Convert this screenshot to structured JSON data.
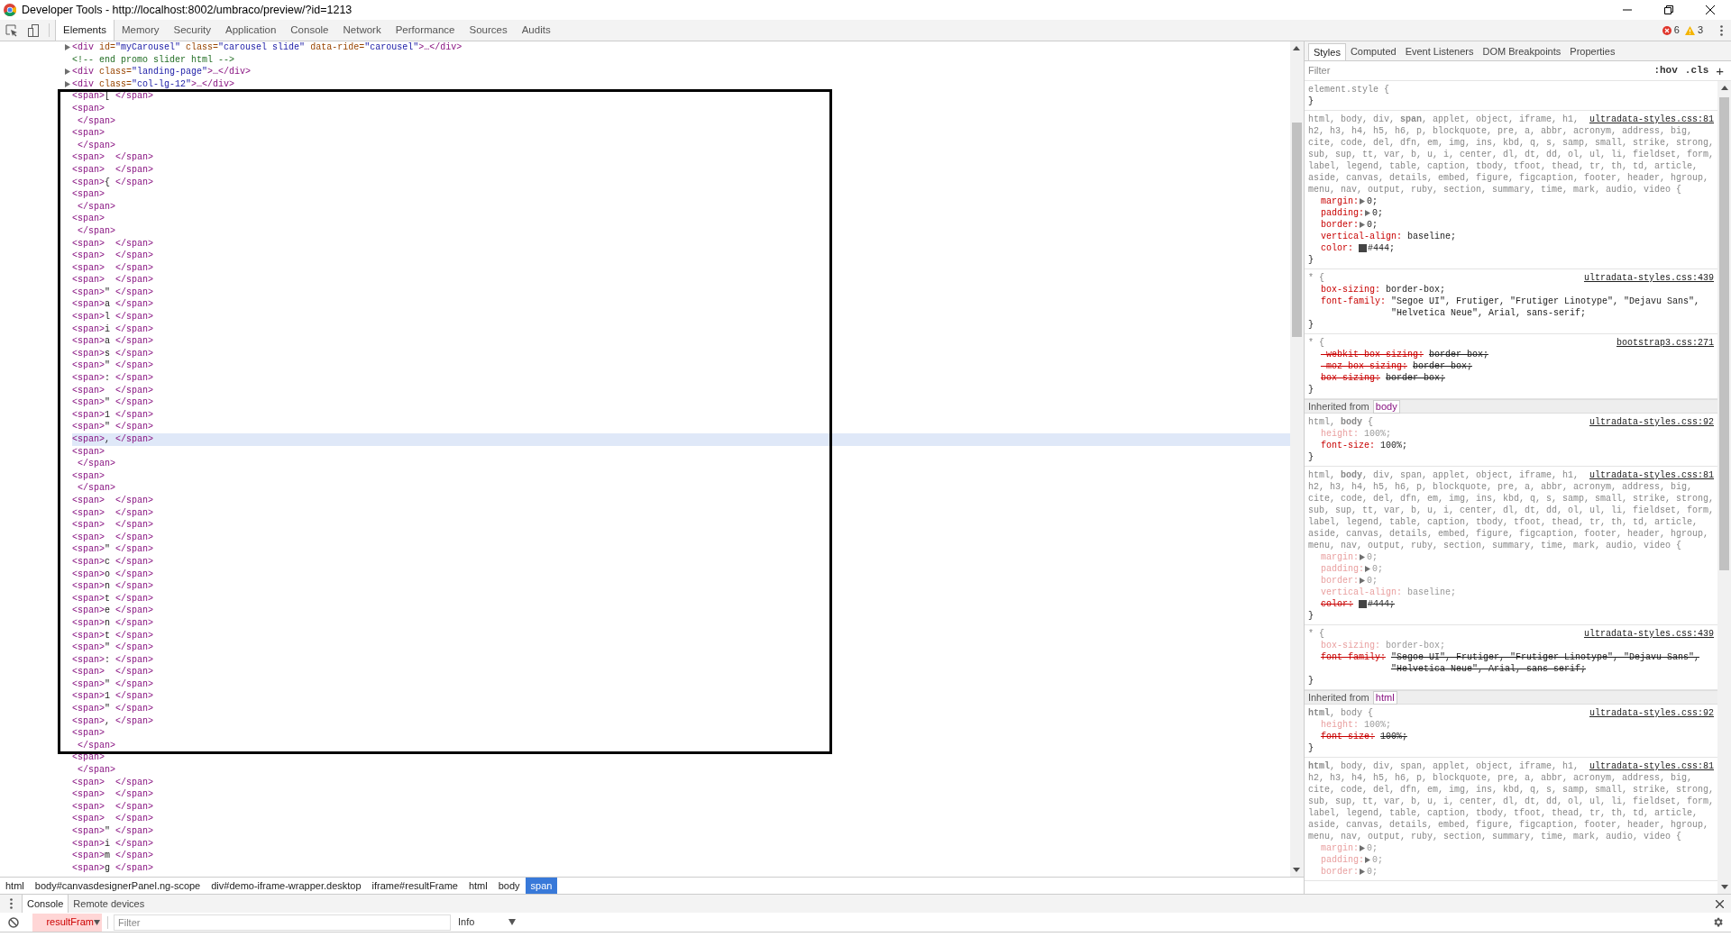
{
  "window": {
    "title": "Developer Tools - http://localhost:8002/umbraco/preview/?id=1213"
  },
  "toolbar": {
    "tabs": [
      {
        "label": "Elements",
        "selected": true
      },
      {
        "label": "Memory",
        "selected": false
      },
      {
        "label": "Security",
        "selected": false
      },
      {
        "label": "Application",
        "selected": false
      },
      {
        "label": "Console",
        "selected": false
      },
      {
        "label": "Network",
        "selected": false
      },
      {
        "label": "Performance",
        "selected": false
      },
      {
        "label": "Sources",
        "selected": false
      },
      {
        "label": "Audits",
        "selected": false
      }
    ],
    "errors": "6",
    "warnings": "3"
  },
  "elements": {
    "lines": [
      {
        "kind": "collapsed",
        "open": "<div",
        "attrs": [
          {
            "name": "id=",
            "value": "\"myCarousel\""
          },
          {
            "name": "class=",
            "value": "\"carousel slide\""
          },
          {
            "name": "data-ride=",
            "value": "\"carousel\""
          }
        ],
        "close": ">…</div>",
        "selected": false
      },
      {
        "kind": "comment",
        "text": "<!-- end promo slider html -->",
        "selected": false
      },
      {
        "kind": "collapsed",
        "open": "<div",
        "attrs": [
          {
            "name": "class=",
            "value": "\"landing-page\""
          }
        ],
        "close": ">…</div>",
        "selected": false
      },
      {
        "kind": "collapsed",
        "open": "<div",
        "attrs": [
          {
            "name": "class=",
            "value": "\"col-lg-12\""
          }
        ],
        "close": ">…</div>",
        "selected": false
      },
      {
        "kind": "span",
        "open": "<span>",
        "content": "[ ",
        "close": "</span>",
        "selected": false
      },
      {
        "kind": "open",
        "open": "<span>",
        "selected": false
      },
      {
        "kind": "close",
        "close": " </span>",
        "selected": false
      },
      {
        "kind": "open",
        "open": "<span>",
        "selected": false
      },
      {
        "kind": "close",
        "close": " </span>",
        "selected": false
      },
      {
        "kind": "span",
        "open": "<span>",
        "close": "</span>",
        "selected": false
      },
      {
        "kind": "span",
        "open": "<span>",
        "close": "</span>",
        "selected": false
      },
      {
        "kind": "span",
        "open": "<span>",
        "content": "{ ",
        "close": "</span>",
        "selected": false
      },
      {
        "kind": "open",
        "open": "<span>",
        "selected": false
      },
      {
        "kind": "close",
        "close": " </span>",
        "selected": false
      },
      {
        "kind": "open",
        "open": "<span>",
        "selected": false
      },
      {
        "kind": "close",
        "close": " </span>",
        "selected": false
      },
      {
        "kind": "span",
        "open": "<span>",
        "close": "</span>",
        "selected": false
      },
      {
        "kind": "span",
        "open": "<span>",
        "close": "</span>",
        "selected": false
      },
      {
        "kind": "span",
        "open": "<span>",
        "close": "</span>",
        "selected": false
      },
      {
        "kind": "span",
        "open": "<span>",
        "close": "</span>",
        "selected": false
      },
      {
        "kind": "span",
        "open": "<span>",
        "content": "\" ",
        "close": "</span>",
        "selected": false
      },
      {
        "kind": "span",
        "open": "<span>",
        "content": "a ",
        "close": "</span>",
        "selected": false
      },
      {
        "kind": "span",
        "open": "<span>",
        "content": "l ",
        "close": "</span>",
        "selected": false
      },
      {
        "kind": "span",
        "open": "<span>",
        "content": "i ",
        "close": "</span>",
        "selected": false
      },
      {
        "kind": "span",
        "open": "<span>",
        "content": "a ",
        "close": "</span>",
        "selected": false
      },
      {
        "kind": "span",
        "open": "<span>",
        "content": "s ",
        "close": "</span>",
        "selected": false
      },
      {
        "kind": "span",
        "open": "<span>",
        "content": "\" ",
        "close": "</span>",
        "selected": false
      },
      {
        "kind": "span",
        "open": "<span>",
        "content": ": ",
        "close": "</span>",
        "selected": false
      },
      {
        "kind": "span",
        "open": "<span>",
        "close": "</span>",
        "selected": false
      },
      {
        "kind": "span",
        "open": "<span>",
        "content": "\" ",
        "close": "</span>",
        "selected": false
      },
      {
        "kind": "span",
        "open": "<span>",
        "content": "1 ",
        "close": "</span>",
        "selected": false
      },
      {
        "kind": "span",
        "open": "<span>",
        "content": "\" ",
        "close": "</span>",
        "selected": false
      },
      {
        "kind": "span",
        "open": "<span>",
        "content": ", ",
        "close": "</span>",
        "selected": true
      },
      {
        "kind": "open",
        "open": "<span>",
        "selected": false
      },
      {
        "kind": "close",
        "close": " </span>",
        "selected": false
      },
      {
        "kind": "open",
        "open": "<span>",
        "selected": false
      },
      {
        "kind": "close",
        "close": " </span>",
        "selected": false
      },
      {
        "kind": "span",
        "open": "<span>",
        "close": "</span>",
        "selected": false
      },
      {
        "kind": "span",
        "open": "<span>",
        "close": "</span>",
        "selected": false
      },
      {
        "kind": "span",
        "open": "<span>",
        "close": "</span>",
        "selected": false
      },
      {
        "kind": "span",
        "open": "<span>",
        "close": "</span>",
        "selected": false
      },
      {
        "kind": "span",
        "open": "<span>",
        "content": "\" ",
        "close": "</span>",
        "selected": false
      },
      {
        "kind": "span",
        "open": "<span>",
        "content": "c ",
        "close": "</span>",
        "selected": false
      },
      {
        "kind": "span",
        "open": "<span>",
        "content": "o ",
        "close": "</span>",
        "selected": false
      },
      {
        "kind": "span",
        "open": "<span>",
        "content": "n ",
        "close": "</span>",
        "selected": false
      },
      {
        "kind": "span",
        "open": "<span>",
        "content": "t ",
        "close": "</span>",
        "selected": false
      },
      {
        "kind": "span",
        "open": "<span>",
        "content": "e ",
        "close": "</span>",
        "selected": false
      },
      {
        "kind": "span",
        "open": "<span>",
        "content": "n ",
        "close": "</span>",
        "selected": false
      },
      {
        "kind": "span",
        "open": "<span>",
        "content": "t ",
        "close": "</span>",
        "selected": false
      },
      {
        "kind": "span",
        "open": "<span>",
        "content": "\" ",
        "close": "</span>",
        "selected": false
      },
      {
        "kind": "span",
        "open": "<span>",
        "content": ": ",
        "close": "</span>",
        "selected": false
      },
      {
        "kind": "span",
        "open": "<span>",
        "close": "</span>",
        "selected": false
      },
      {
        "kind": "span",
        "open": "<span>",
        "content": "\" ",
        "close": "</span>",
        "selected": false
      },
      {
        "kind": "span",
        "open": "<span>",
        "content": "1 ",
        "close": "</span>",
        "selected": false
      },
      {
        "kind": "span",
        "open": "<span>",
        "content": "\" ",
        "close": "</span>",
        "selected": false
      },
      {
        "kind": "span",
        "open": "<span>",
        "content": ", ",
        "close": "</span>",
        "selected": false
      },
      {
        "kind": "open",
        "open": "<span>",
        "selected": false
      },
      {
        "kind": "close",
        "close": " </span>",
        "selected": false
      },
      {
        "kind": "open",
        "open": "<span>",
        "selected": false
      },
      {
        "kind": "close",
        "close": " </span>",
        "selected": false
      },
      {
        "kind": "span",
        "open": "<span>",
        "close": "</span>",
        "selected": false
      },
      {
        "kind": "span",
        "open": "<span>",
        "close": "</span>",
        "selected": false
      },
      {
        "kind": "span",
        "open": "<span>",
        "close": "</span>",
        "selected": false
      },
      {
        "kind": "span",
        "open": "<span>",
        "close": "</span>",
        "selected": false
      },
      {
        "kind": "span",
        "open": "<span>",
        "content": "\" ",
        "close": "</span>",
        "selected": false
      },
      {
        "kind": "span",
        "open": "<span>",
        "content": "i ",
        "close": "</span>",
        "selected": false
      },
      {
        "kind": "span",
        "open": "<span>",
        "content": "m ",
        "close": "</span>",
        "selected": false
      },
      {
        "kind": "span",
        "open": "<span>",
        "content": "g ",
        "close": "</span>",
        "selected": false
      }
    ]
  },
  "breadcrumbs": [
    {
      "label": "html",
      "selected": false
    },
    {
      "label": "body#canvasdesignerPanel.ng-scope",
      "selected": false
    },
    {
      "label": "div#demo-iframe-wrapper.desktop",
      "selected": false
    },
    {
      "label": "iframe#resultFrame",
      "selected": false
    },
    {
      "label": "html",
      "selected": false
    },
    {
      "label": "body",
      "selected": false
    },
    {
      "label": "span",
      "selected": true
    }
  ],
  "styles": {
    "tabs": [
      {
        "label": "Styles",
        "selected": true
      },
      {
        "label": "Computed",
        "selected": false
      },
      {
        "label": "Event Listeners",
        "selected": false
      },
      {
        "label": "DOM Breakpoints",
        "selected": false
      },
      {
        "label": "Properties",
        "selected": false
      }
    ],
    "filter": {
      "placeholder": "Filter"
    },
    "hov": ":hov",
    "cls": ".cls",
    "add": "+",
    "sections": [
      {
        "kind": "rule",
        "selector": [
          "element.style {"
        ],
        "end": "}"
      },
      {
        "kind": "rule",
        "source": "ultradata-styles.css:81",
        "selector": [
          "html, body, div, **span**, applet, object, iframe, h1,",
          "h2, h3, h4, h5, h6, p, blockquote, pre, a, abbr, acronym, address, big,",
          "cite, code, del, dfn, em, img, ins, kbd, q, s, samp, small, strike, strong,",
          "sub, sup, tt, var, b, u, i, center, dl, dt, dd, ol, ul, li, fieldset, form,",
          "label, legend, table, caption, tbody, tfoot, thead, tr, th, td, article,",
          "aside, canvas, details, embed, figure, figcaption, footer, header, hgroup,",
          "menu, nav, output, ruby, section, summary, time, mark, audio, video {"
        ],
        "props": [
          {
            "name": "margin:",
            "value": "0;",
            "expandable": true,
            "overridden": false,
            "inactive": false
          },
          {
            "name": "padding:",
            "value": "0;",
            "expandable": true,
            "overridden": false,
            "inactive": false
          },
          {
            "name": "border:",
            "value": "0;",
            "expandable": true,
            "overridden": false,
            "inactive": false
          },
          {
            "name": "vertical-align:",
            "value": "baseline;",
            "expandable": false,
            "overridden": false,
            "inactive": false
          },
          {
            "name": "color:",
            "value": "#444;",
            "expandable": false,
            "color": "#444444",
            "overridden": false,
            "inactive": false
          }
        ],
        "end": "}"
      },
      {
        "kind": "rule",
        "source": "ultradata-styles.css:439",
        "selector": [
          "* {"
        ],
        "props": [
          {
            "name": "box-sizing:",
            "value": "border-box;",
            "expandable": false,
            "overridden": false,
            "inactive": false
          },
          {
            "name": "font-family:",
            "value": "\"Segoe UI\", Frutiger, \"Frutiger Linotype\", \"Dejavu Sans\", \"Helvetica Neue\", Arial, sans-serif;",
            "expandable": false,
            "overridden": false,
            "inactive": false
          }
        ],
        "end": "}"
      },
      {
        "kind": "rule",
        "source": "bootstrap3.css:271",
        "selector": [
          "* {"
        ],
        "props": [
          {
            "name": "-webkit-box-sizing:",
            "value": "border-box;",
            "expandable": false,
            "overridden": true,
            "inactive": false
          },
          {
            "name": "-moz-box-sizing:",
            "value": "border-box;",
            "expandable": false,
            "overridden": true,
            "inactive": false
          },
          {
            "name": "box-sizing:",
            "value": "border-box;",
            "expandable": false,
            "overridden": true,
            "inactive": false
          }
        ],
        "end": "}"
      },
      {
        "kind": "inherited",
        "label": "Inherited from",
        "tag": "body"
      },
      {
        "kind": "rule",
        "source": "ultradata-styles.css:92",
        "selector": [
          "html, **body** {"
        ],
        "props": [
          {
            "name": "height:",
            "value": "100%;",
            "expandable": false,
            "overridden": false,
            "inactive": true
          },
          {
            "name": "font-size:",
            "value": "100%;",
            "expandable": false,
            "overridden": false,
            "inactive": false
          }
        ],
        "end": "}"
      },
      {
        "kind": "rule",
        "source": "ultradata-styles.css:81",
        "selector": [
          "html, **body**, div, span, applet, object, iframe, h1,",
          "h2, h3, h4, h5, h6, p, blockquote, pre, a, abbr, acronym, address, big,",
          "cite, code, del, dfn, em, img, ins, kbd, q, s, samp, small, strike, strong,",
          "sub, sup, tt, var, b, u, i, center, dl, dt, dd, ol, ul, li, fieldset, form,",
          "label, legend, table, caption, tbody, tfoot, thead, tr, th, td, article,",
          "aside, canvas, details, embed, figure, figcaption, footer, header, hgroup,",
          "menu, nav, output, ruby, section, summary, time, mark, audio, video {"
        ],
        "props": [
          {
            "name": "margin:",
            "value": "0;",
            "expandable": true,
            "overridden": false,
            "inactive": true
          },
          {
            "name": "padding:",
            "value": "0;",
            "expandable": true,
            "overridden": false,
            "inactive": true
          },
          {
            "name": "border:",
            "value": "0;",
            "expandable": true,
            "overridden": false,
            "inactive": true
          },
          {
            "name": "vertical-align:",
            "value": "baseline;",
            "expandable": false,
            "overridden": false,
            "inactive": true
          },
          {
            "name": "color:",
            "value": "#444;",
            "expandable": false,
            "color": "#444444",
            "overridden": true,
            "inactive": false
          }
        ],
        "end": "}"
      },
      {
        "kind": "rule",
        "source": "ultradata-styles.css:439",
        "selector": [
          "* {"
        ],
        "props": [
          {
            "name": "box-sizing:",
            "value": "border-box;",
            "expandable": false,
            "overridden": false,
            "inactive": true
          },
          {
            "name": "font-family:",
            "value": "\"Segoe UI\", Frutiger, \"Frutiger Linotype\", \"Dejavu Sans\", \"Helvetica Neue\", Arial, sans-serif;",
            "expandable": false,
            "overridden": true,
            "inactive": false
          }
        ],
        "end": "}"
      },
      {
        "kind": "inherited",
        "label": "Inherited from",
        "tag": "html"
      },
      {
        "kind": "rule",
        "source": "ultradata-styles.css:92",
        "selector": [
          "**html**, body {"
        ],
        "props": [
          {
            "name": "height:",
            "value": "100%;",
            "expandable": false,
            "overridden": false,
            "inactive": true
          },
          {
            "name": "font-size:",
            "value": "100%;",
            "expandable": false,
            "overridden": true,
            "inactive": false
          }
        ],
        "end": "}"
      },
      {
        "kind": "rule",
        "source": "ultradata-styles.css:81",
        "selector": [
          "**html**, body, div, span, applet, object, iframe, h1,",
          "h2, h3, h4, h5, h6, p, blockquote, pre, a, abbr, acronym, address, big,",
          "cite, code, del, dfn, em, img, ins, kbd, q, s, samp, small, strike, strong,",
          "sub, sup, tt, var, b, u, i, center, dl, dt, dd, ol, ul, li, fieldset, form,",
          "label, legend, table, caption, tbody, tfoot, thead, tr, th, td, article,",
          "aside, canvas, details, embed, figure, figcaption, footer, header, hgroup,",
          "menu, nav, output, ruby, section, summary, time, mark, audio, video {"
        ],
        "props": [
          {
            "name": "margin:",
            "value": "0;",
            "expandable": true,
            "overridden": false,
            "inactive": true
          },
          {
            "name": "padding:",
            "value": "0;",
            "expandable": true,
            "overridden": false,
            "inactive": true
          },
          {
            "name": "border:",
            "value": "0;",
            "expandable": true,
            "overridden": false,
            "inactive": true
          }
        ]
      }
    ]
  },
  "drawer": {
    "tabs": [
      {
        "label": "Console",
        "selected": true
      },
      {
        "label": "Remote devices",
        "selected": false
      }
    ],
    "context": "resultFram",
    "filter": {
      "placeholder": "Filter"
    },
    "level": "Info"
  }
}
